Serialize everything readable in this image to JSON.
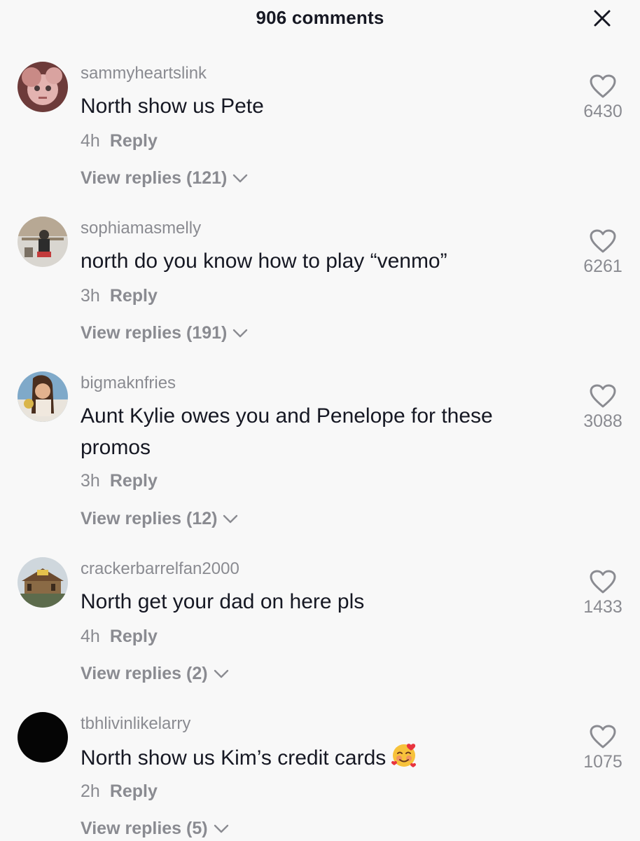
{
  "header": {
    "title": "906 comments",
    "close_icon": "close-icon"
  },
  "comments": [
    {
      "username": "sammyheartslink",
      "text": "North show us Pete",
      "time": "4h",
      "reply_label": "Reply",
      "view_replies": "View replies (121)",
      "likes": "6430"
    },
    {
      "username": "sophiamasmelly",
      "text": "north do you know how to play “venmo”",
      "time": "3h",
      "reply_label": "Reply",
      "view_replies": "View replies (191)",
      "likes": "6261"
    },
    {
      "username": "bigmaknfries",
      "text": "Aunt Kylie owes you and Penelope for these promos",
      "time": "3h",
      "reply_label": "Reply",
      "view_replies": "View replies (12)",
      "likes": "3088"
    },
    {
      "username": "crackerbarrelfan2000",
      "text": "North get your dad on here pls",
      "time": "4h",
      "reply_label": "Reply",
      "view_replies": "View replies (2)",
      "likes": "1433"
    },
    {
      "username": "tbhlivinlikelarry",
      "text": "North show us Kim’s credit cards",
      "emoji": "smiling-face-with-hearts-icon",
      "time": "2h",
      "reply_label": "Reply",
      "view_replies": "View replies (5)",
      "likes": "1075"
    }
  ],
  "icons": {
    "like": "heart-outline-icon",
    "expand": "chevron-down-icon"
  },
  "colors": {
    "background": "#f8f8f8",
    "primary_text": "#161823",
    "secondary_text": "#8a8b91"
  }
}
